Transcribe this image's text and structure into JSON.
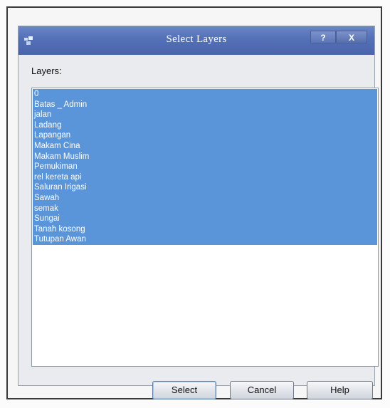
{
  "dialog": {
    "title": "Select Layers",
    "help_caption": "?",
    "close_caption": "X"
  },
  "layers_label": "Layers:",
  "layers": [
    {
      "label": "0",
      "selected": true
    },
    {
      "label": "Batas _ Admin",
      "selected": true
    },
    {
      "label": "jalan",
      "selected": true
    },
    {
      "label": "Ladang",
      "selected": true
    },
    {
      "label": "Lapangan",
      "selected": true
    },
    {
      "label": "Makam Cina",
      "selected": true
    },
    {
      "label": "Makam Muslim",
      "selected": true
    },
    {
      "label": "Pemukiman",
      "selected": true
    },
    {
      "label": "rel kereta api",
      "selected": true
    },
    {
      "label": "Saluran Irigasi",
      "selected": true
    },
    {
      "label": "Sawah",
      "selected": true
    },
    {
      "label": "semak",
      "selected": true
    },
    {
      "label": "Sungai",
      "selected": true
    },
    {
      "label": "Tanah kosong",
      "selected": true
    },
    {
      "label": "Tutupan Awan",
      "selected": true
    }
  ],
  "buttons": {
    "select": "Select",
    "cancel": "Cancel",
    "help": "Help"
  },
  "colors": {
    "titlebar": "#5470b6",
    "selection": "#5b95d9"
  }
}
